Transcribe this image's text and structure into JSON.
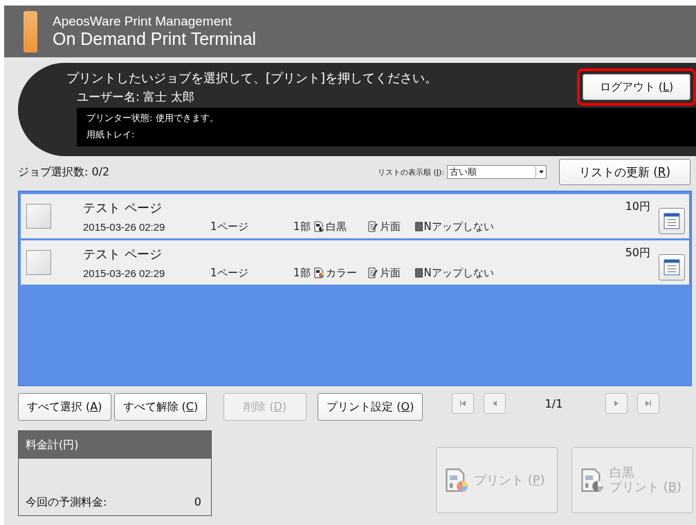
{
  "header": {
    "product": "ApeosWare Print Management",
    "title": "On Demand Print Terminal"
  },
  "banner": {
    "instruction": "プリントしたいジョブを選択して、[プリント]を押してください。",
    "user": "ユーザー名: 富士 太郎",
    "printer_status": "プリンター状態: 使用できます。",
    "paper_tray": "用紙トレイ:"
  },
  "logout": {
    "before": "ログアウト (",
    "key": "L",
    "after": ")",
    "highlighted": true,
    "disabled": false
  },
  "selection_count": "ジョブ選択数: 0/2",
  "sort": {
    "label_before": "リストの表示順 (",
    "key": "I",
    "label_after": "):",
    "value": "古い順"
  },
  "refresh": {
    "before": "リストの更新 (",
    "key": "R",
    "after": ")",
    "disabled": false
  },
  "jobs": [
    {
      "name": "テスト ページ",
      "date": "2015-03-26 02:29",
      "pages": "1ページ",
      "copies": "1部",
      "color_mode": "白黒",
      "color": false,
      "sides": "片面",
      "nup": "Nアップしない",
      "price": "10円",
      "checked": false
    },
    {
      "name": "テスト ページ",
      "date": "2015-03-26 02:29",
      "pages": "1ページ",
      "copies": "1部",
      "color_mode": "カラー",
      "color": true,
      "sides": "片面",
      "nup": "Nアップしない",
      "price": "50円",
      "checked": false
    }
  ],
  "actions": [
    {
      "before": "すべて選択 (",
      "key": "A",
      "after": ")",
      "disabled": false
    },
    {
      "before": "すべて解除 (",
      "key": "C",
      "after": ")",
      "disabled": false
    },
    {
      "before": "削除 (",
      "key": "D",
      "after": ")",
      "disabled": true
    },
    {
      "before": "プリント設定 (",
      "key": "O",
      "after": ")",
      "disabled": false
    }
  ],
  "pager": {
    "page": "1/1",
    "first_disabled": true,
    "prev_disabled": true,
    "next_disabled": true,
    "last_disabled": true
  },
  "fee": {
    "title": "料金計(円)",
    "label": "今回の予測料金:",
    "value": "0"
  },
  "print_buttons": [
    {
      "before": "プリント (",
      "key": "P",
      "after": ")",
      "color": true,
      "disabled": true
    },
    {
      "line1": "白黒",
      "before": "プリント (",
      "key": "B",
      "after": ")",
      "color": false,
      "disabled": true
    }
  ]
}
